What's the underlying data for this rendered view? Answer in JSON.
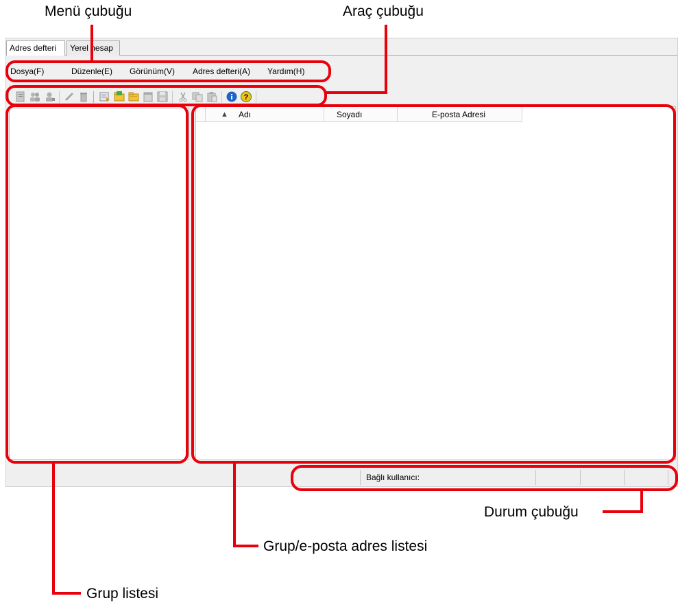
{
  "callouts": {
    "menubar": "Menü çubuğu",
    "toolbar": "Araç çubuğu",
    "statusbar": "Durum çubuğu",
    "addresslist": "Grup/e-posta adres listesi",
    "grouplist": "Grup listesi"
  },
  "tabs": [
    {
      "label": "Adres defteri",
      "active": true
    },
    {
      "label": "Yerel hesap",
      "active": false
    }
  ],
  "menu": [
    "Dosya(F)",
    "Düzenle(E)",
    "Görünüm(V)",
    "Adres defteri(A)",
    "Yardım(H)"
  ],
  "toolbar_icons": [
    "new-entry-icon",
    "group-users-icon",
    "user-icon",
    "edit-icon",
    "delete-icon",
    "import-icon",
    "open-folder-icon",
    "folder-icon",
    "calendar-icon",
    "save-icon",
    "cut-icon",
    "copy-icon",
    "paste-icon",
    "info-icon",
    "help-icon"
  ],
  "address_table": {
    "sort_indicator": "▲",
    "columns": [
      "Adı",
      "Soyadı",
      "E-posta Adresi"
    ]
  },
  "statusbar": {
    "connected_user_label": "Bağlı kullanıcı:"
  },
  "colors": {
    "highlight": "#e8000b",
    "info_blue": "#1e64c8",
    "help_yellow": "#f0c020"
  }
}
